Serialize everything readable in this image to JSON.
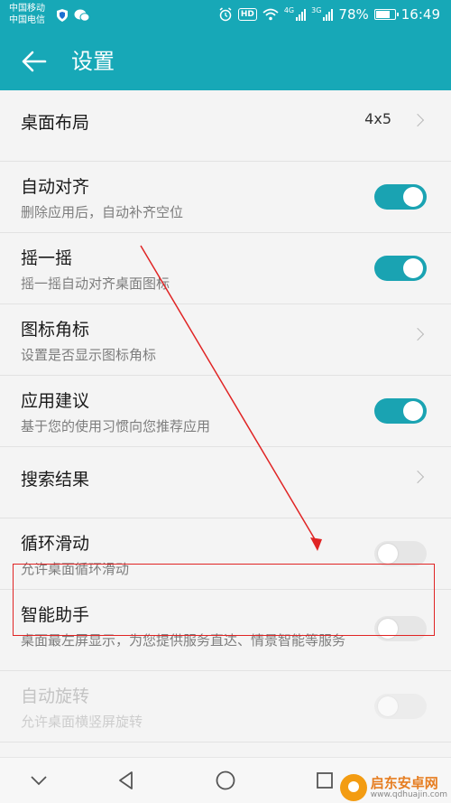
{
  "status_bar": {
    "carrier_1": "中国移动",
    "carrier_2": "中国电信",
    "net_1": "4G",
    "net_2": "3G",
    "battery": "78%",
    "time": "16:49",
    "hd": "HD"
  },
  "app_bar": {
    "title": "设置",
    "back_icon": "arrow-left-icon"
  },
  "rows": [
    {
      "title": "桌面布局",
      "value": "4x5",
      "control": "chevron"
    },
    {
      "title": "自动对齐",
      "subtitle": "删除应用后，自动补齐空位",
      "control": "toggle",
      "state": "on"
    },
    {
      "title": "摇一摇",
      "subtitle": "摇一摇自动对齐桌面图标",
      "control": "toggle",
      "state": "on"
    },
    {
      "title": "图标角标",
      "subtitle": "设置是否显示图标角标",
      "control": "chevron"
    },
    {
      "title": "应用建议",
      "subtitle": "基于您的使用习惯向您推荐应用",
      "control": "toggle",
      "state": "on"
    },
    {
      "title": "搜索结果",
      "control": "chevron"
    },
    {
      "title": "循环滑动",
      "subtitle": "允许桌面循环滑动",
      "control": "toggle",
      "state": "off"
    },
    {
      "title": "智能助手",
      "subtitle": "桌面最左屏显示，为您提供服务直达、情景智能等服务",
      "control": "toggle",
      "state": "off"
    },
    {
      "title": "自动旋转",
      "subtitle": "允许桌面横竖屏旋转",
      "control": "toggle",
      "state": "off",
      "disabled": true
    }
  ],
  "nav_bar": {
    "icons": [
      "chevron-down-icon",
      "back-triangle-icon",
      "home-circle-icon",
      "recents-square-icon"
    ]
  },
  "watermark": {
    "name": "启东安卓网",
    "url": "www.qdhuajin.com"
  },
  "colors": {
    "accent": "#17a8b7",
    "toggle_on": "#1aa3b2",
    "annotation": "#e02424"
  }
}
